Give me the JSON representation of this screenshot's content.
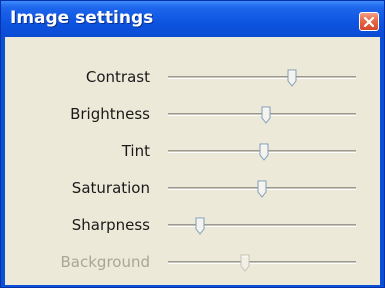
{
  "window": {
    "title": "Image settings"
  },
  "sliders": [
    {
      "label": "Contrast",
      "value": 0.66,
      "enabled": true
    },
    {
      "label": "Brightness",
      "value": 0.52,
      "enabled": true
    },
    {
      "label": "Tint",
      "value": 0.51,
      "enabled": true
    },
    {
      "label": "Saturation",
      "value": 0.5,
      "enabled": true
    },
    {
      "label": "Sharpness",
      "value": 0.17,
      "enabled": true
    },
    {
      "label": "Background",
      "value": 0.41,
      "enabled": false
    }
  ],
  "colors": {
    "titlebar": "#0a54e0",
    "panel": "#ece9d8",
    "close": "#e0553a",
    "disabled_text": "#a9a699"
  },
  "icons": {
    "close": "close-icon"
  }
}
